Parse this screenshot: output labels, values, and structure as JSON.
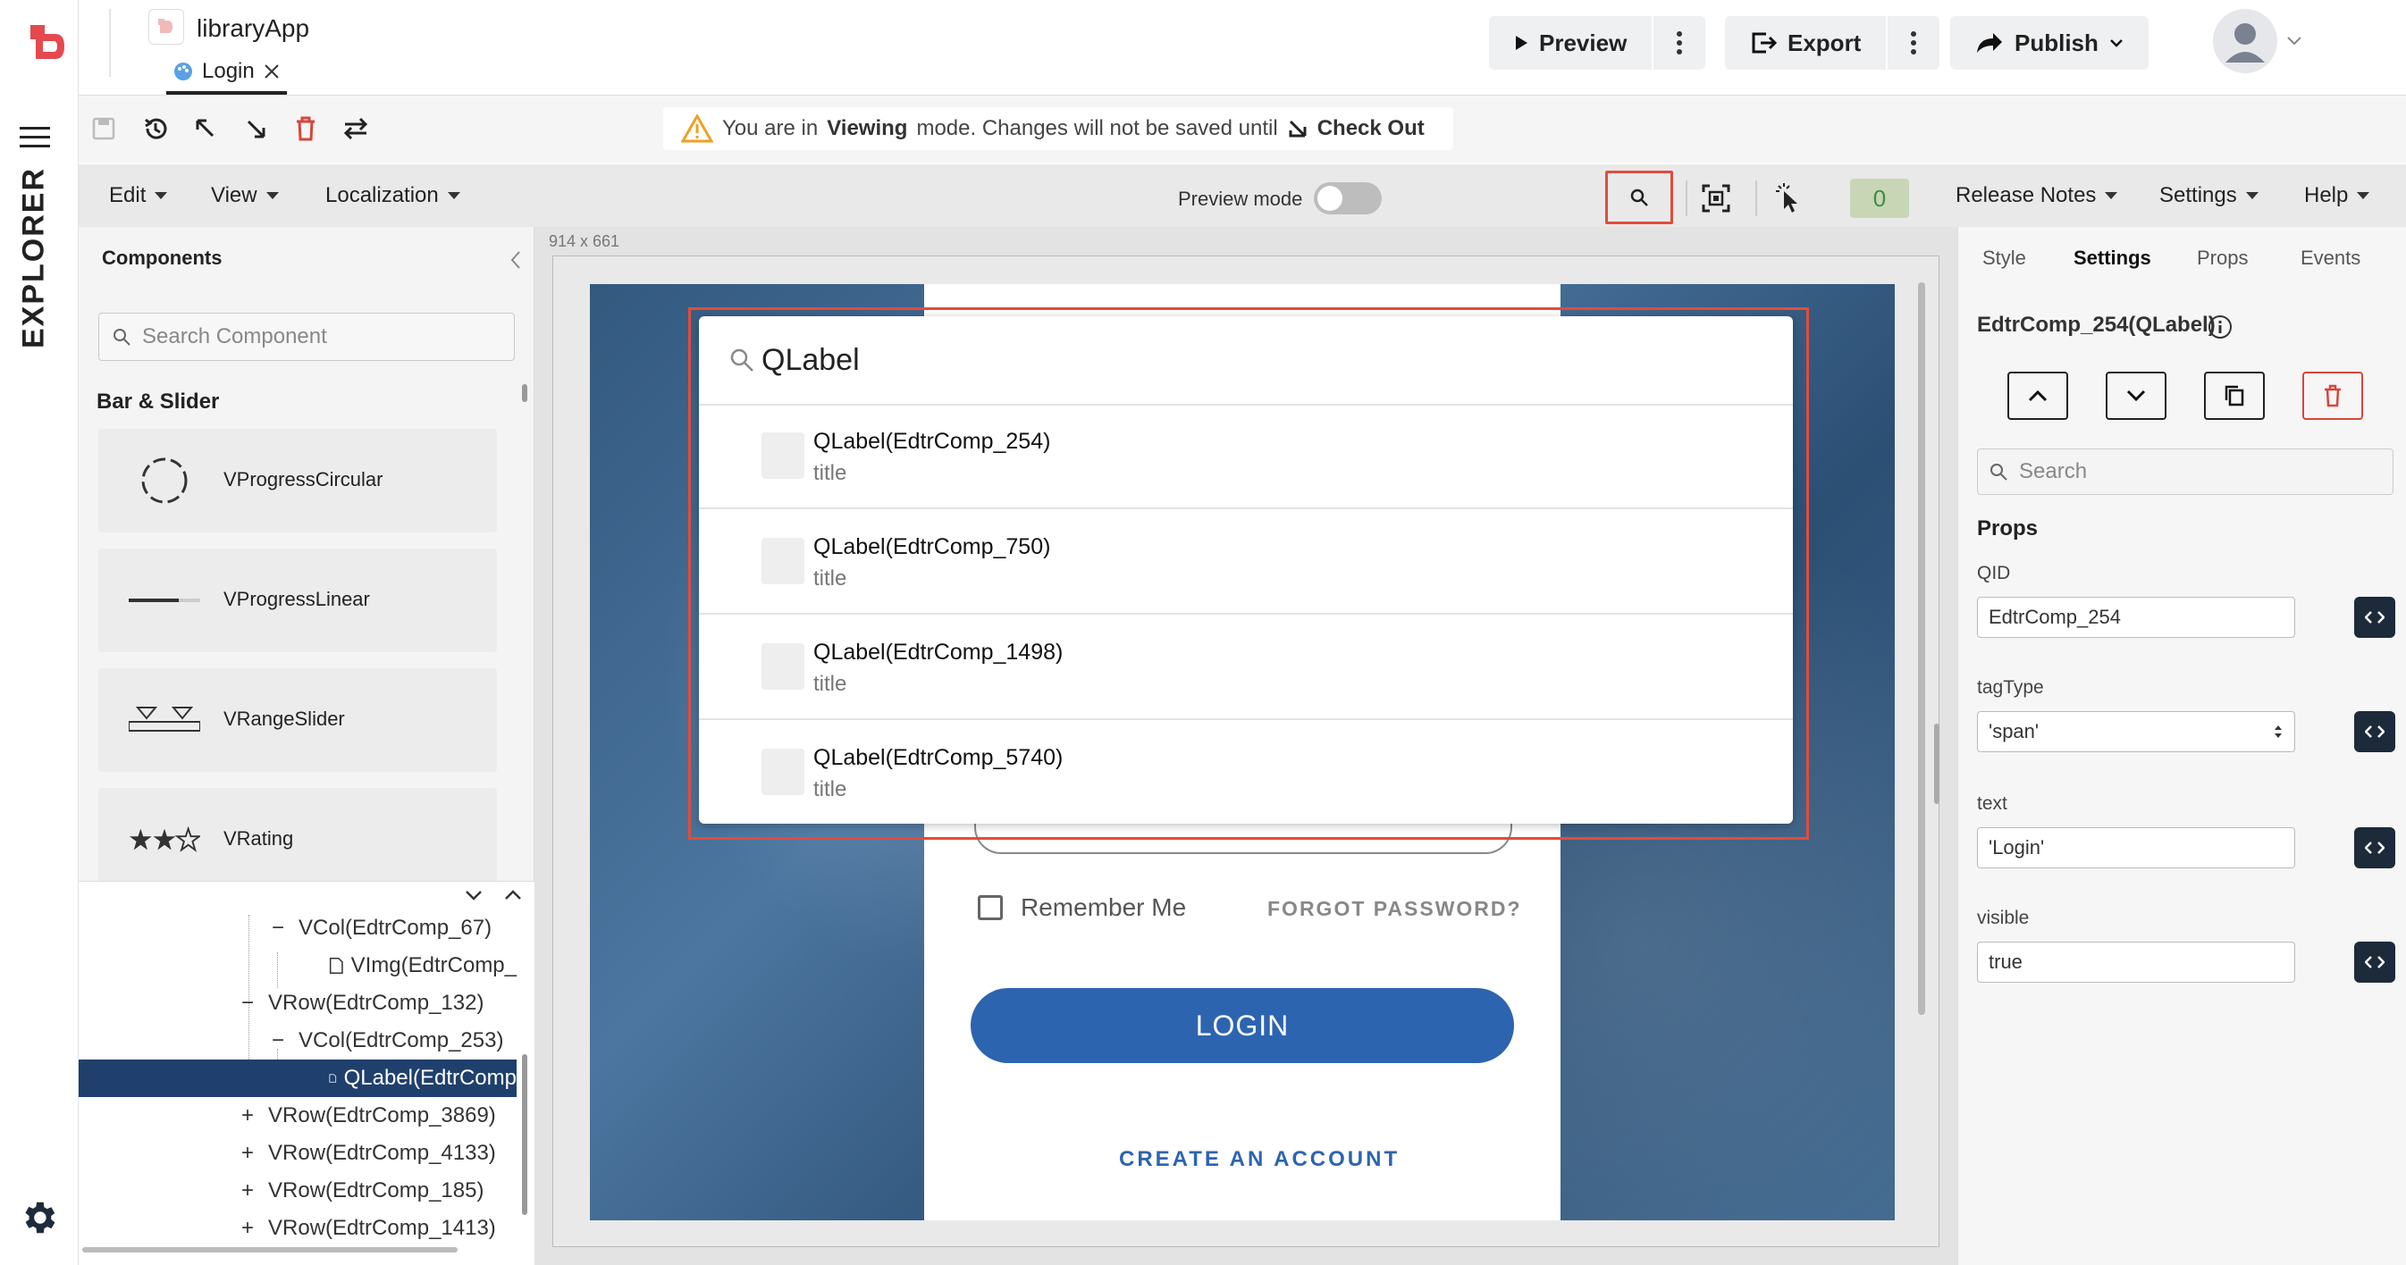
{
  "header": {
    "app_title": "libraryApp",
    "file_tab": "Login",
    "preview_label": "Preview",
    "export_label": "Export",
    "publish_label": "Publish"
  },
  "rail": {
    "explorer_label": "EXPLORER"
  },
  "notice": {
    "prefix": "You are in",
    "mode": "Viewing",
    "suffix": "mode. Changes will not be saved until",
    "action": "Check Out"
  },
  "menubar": {
    "edit": "Edit",
    "view": "View",
    "localization": "Localization",
    "preview_mode": "Preview mode",
    "badge_count": "0",
    "release_notes": "Release Notes",
    "settings": "Settings",
    "help": "Help"
  },
  "components_panel": {
    "title": "Components",
    "search_placeholder": "Search Component",
    "section": "Bar & Slider",
    "items": [
      {
        "label": "VProgressCircular",
        "icon": "progress-circular-icon"
      },
      {
        "label": "VProgressLinear",
        "icon": "progress-linear-icon"
      },
      {
        "label": "VRangeSlider",
        "icon": "range-slider-icon"
      },
      {
        "label": "VRating",
        "icon": "rating-stars-icon"
      }
    ]
  },
  "tree": [
    {
      "prefix": "−",
      "label": "VCol(EdtrComp_67)"
    },
    {
      "prefix": "",
      "label": "VImg(EdtrComp_"
    },
    {
      "prefix": "−",
      "label": "VRow(EdtrComp_132)"
    },
    {
      "prefix": "−",
      "label": "VCol(EdtrComp_253)"
    },
    {
      "prefix": "",
      "label": "QLabel(EdtrComp"
    },
    {
      "prefix": "+",
      "label": "VRow(EdtrComp_3869)"
    },
    {
      "prefix": "+",
      "label": "VRow(EdtrComp_4133)"
    },
    {
      "prefix": "+",
      "label": "VRow(EdtrComp_185)"
    },
    {
      "prefix": "+",
      "label": "VRow(EdtrComp_1413)"
    }
  ],
  "canvas": {
    "dimensions": "914 x 661",
    "remember_me": "Remember Me",
    "forgot_password": "FORGOT PASSWORD?",
    "login_button": "LOGIN",
    "create_account": "CREATE AN ACCOUNT"
  },
  "search_overlay": {
    "query": "QLabel",
    "results": [
      {
        "title": "QLabel(EdtrComp_254)",
        "subtitle": "title"
      },
      {
        "title": "QLabel(EdtrComp_750)",
        "subtitle": "title"
      },
      {
        "title": "QLabel(EdtrComp_1498)",
        "subtitle": "title"
      },
      {
        "title": "QLabel(EdtrComp_5740)",
        "subtitle": "title"
      }
    ]
  },
  "right_panel": {
    "tabs": [
      "Style",
      "Settings",
      "Props",
      "Events"
    ],
    "active_tab": "Settings",
    "component_name": "EdtrComp_254(QLabel)",
    "search_placeholder": "Search",
    "props_heading": "Props",
    "props": [
      {
        "label": "QID",
        "value": "EdtrComp_254"
      },
      {
        "label": "tagType",
        "value": "'span'"
      },
      {
        "label": "text",
        "value": "'Login'"
      },
      {
        "label": "visible",
        "value": "true"
      }
    ]
  },
  "colors": {
    "highlight_outline": "#e44b3a",
    "selected_row": "#1f3f6d",
    "login_button": "#2d64b0",
    "delete_red": "#d9453a"
  }
}
